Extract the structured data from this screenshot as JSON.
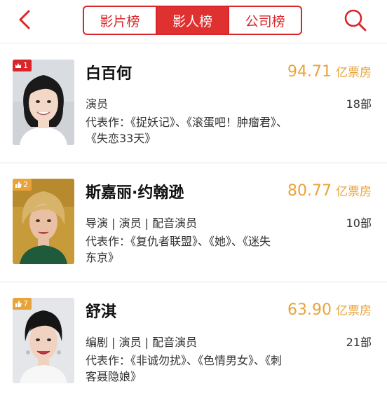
{
  "header": {
    "tabs": [
      {
        "label": "影片榜",
        "active": false
      },
      {
        "label": "影人榜",
        "active": true
      },
      {
        "label": "公司榜",
        "active": false
      }
    ],
    "back_icon": "chevron-left-icon",
    "search_icon": "search-icon"
  },
  "colors": {
    "accent": "#d9262b",
    "boxoffice": "#e8a33a",
    "gold_badge": "#e8a33a"
  },
  "people": [
    {
      "rank": "1",
      "name": "白百何",
      "boxoffice_value": "94.71",
      "boxoffice_unit": "亿票房",
      "role": "演员",
      "works_count": "18部",
      "rep_line1": "代表作：《捉妖记》、《滚蛋吧！肿瘤君》、",
      "rep_line2": "《失恋33天》"
    },
    {
      "rank": "2",
      "name": "斯嘉丽·约翰逊",
      "boxoffice_value": "80.77",
      "boxoffice_unit": "亿票房",
      "role": "导演 | 演员 | 配音演员",
      "works_count": "10部",
      "rep_line1": "代表作：《复仇者联盟》、《她》、《迷失",
      "rep_line2": "东京》"
    },
    {
      "rank": "7",
      "name": "舒淇",
      "boxoffice_value": "63.90",
      "boxoffice_unit": "亿票房",
      "role": "编剧 | 演员 | 配音演员",
      "works_count": "21部",
      "rep_line1": "代表作：《非诚勿扰》、《色情男女》、《刺",
      "rep_line2": "客聂隐娘》"
    }
  ]
}
